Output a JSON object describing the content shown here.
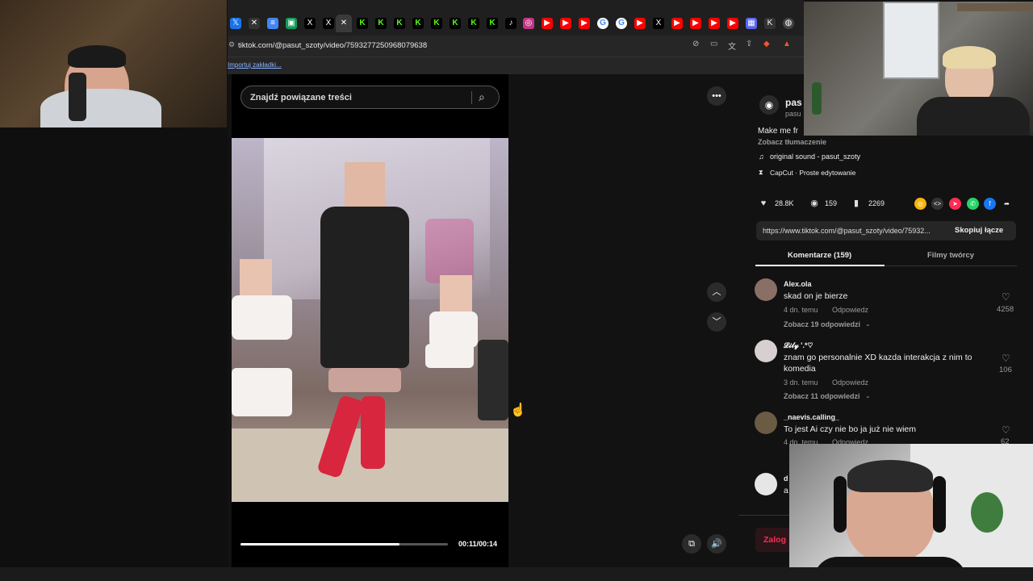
{
  "browser": {
    "url": "tiktok.com/@pasut_szoty/video/7593277250968079638",
    "bookmarks_label": "Importuj zakładki..."
  },
  "colors": {
    "accent": "#fe2c55",
    "background": "#121212",
    "panel": "#262626"
  },
  "search": {
    "placeholder": "Znajdź powiązane treści",
    "icon": "search-icon"
  },
  "video": {
    "time": "00:11/00:14",
    "progress": 0.767
  },
  "author": {
    "name": "pas",
    "handle": "pasu",
    "description": "Make me fr",
    "translate": "Zobacz tłumaczenie",
    "sound": "original sound - pasut_szoty",
    "capcut": "CapCut · Proste edytowanie"
  },
  "stats": {
    "likes": "28.8K",
    "comments": "159",
    "saves": "2269"
  },
  "link": {
    "url": "https://www.tiktok.com/@pasut_szoty/video/75932...",
    "copy_label": "Skopiuj łącze"
  },
  "tabs": {
    "comments": "Komentarze (159)",
    "creator": "Filmy twórcy"
  },
  "comments": [
    {
      "user": "Alex.ola",
      "text": "skad on je bierze",
      "age": "4 dn. temu",
      "reply": "Odpowiedz",
      "replies": "Zobacz 19 odpowiedzi",
      "likes": "4258"
    },
    {
      "user": "𝓛𝓲𝓵𝔂 '.*♡",
      "text": "znam go personalnie XD kazda interakcja z nim to",
      "text2": "komedia",
      "age": "3 dn. temu",
      "reply": "Odpowiedz",
      "replies": "Zobacz 11 odpowiedzi",
      "likes": "106"
    },
    {
      "user": "_naevis.calling_",
      "text": "To jest Ai czy nie bo ja już nie wiem",
      "age": "4 dn. temu",
      "reply": "Odpowiedz",
      "likes": "62"
    },
    {
      "user": "d",
      "text": "a"
    }
  ],
  "login": {
    "label": "Zalog"
  }
}
